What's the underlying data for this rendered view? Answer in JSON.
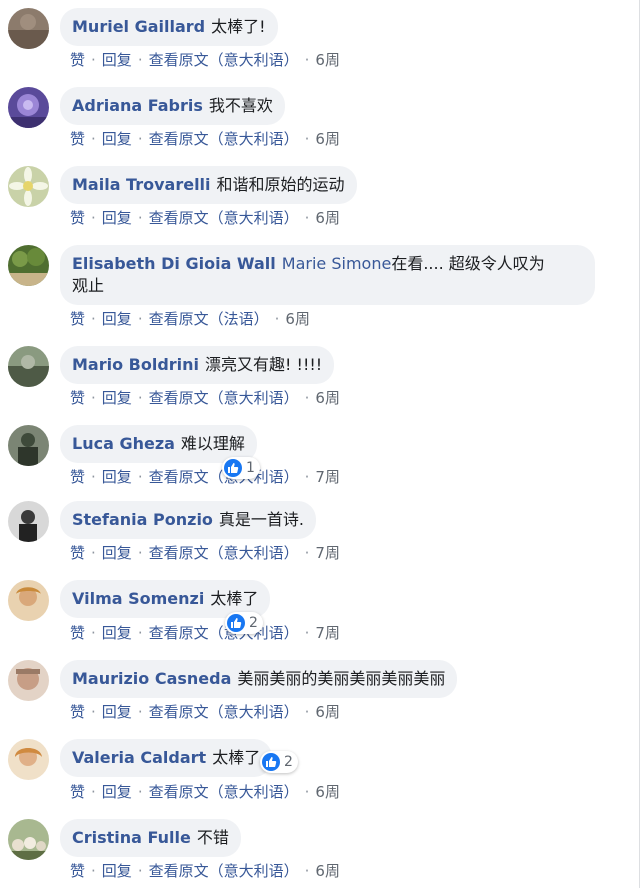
{
  "actions": {
    "like": "赞",
    "reply": "回复",
    "see_original": "查看原文",
    "separator": "·"
  },
  "comments": [
    {
      "author": "Muriel Gaillard",
      "text": "太棒了!",
      "lang": "（意大利语）",
      "time": "6周",
      "avatar_color": "#7a6a5e"
    },
    {
      "author": "Adriana Fabris",
      "text": "我不喜欢",
      "lang": "（意大利语）",
      "time": "6周",
      "avatar_color": "#6b55a8"
    },
    {
      "author": "Maila Trovarelli",
      "text": "和谐和原始的运动",
      "lang": "（意大利语）",
      "time": "6周",
      "avatar_color": "#d7dcc0"
    },
    {
      "author": "Elisabeth Di Gioia Wall",
      "mention": "Marie Simone",
      "text": "在看.... 超级令人叹为",
      "text2": "观止",
      "lang": "（法语）",
      "time": "6周",
      "avatar_color": "#5d7a3c"
    },
    {
      "author": "Mario Boldrini",
      "text": "漂亮又有趣! !!!!",
      "lang": "（意大利语）",
      "time": "6周",
      "avatar_color": "#6c7a5f"
    },
    {
      "author": "Luca Gheza",
      "text": "难以理解",
      "lang": "（意大利语）",
      "time": "7周",
      "avatar_color": "#6f7768",
      "reactions": "1"
    },
    {
      "author": "Stefania Ponzio",
      "text": "真是一首诗.",
      "lang": "（意大利语）",
      "time": "7周",
      "avatar_color": "#4a4a4a"
    },
    {
      "author": "Vilma Somenzi",
      "text": "太棒了",
      "lang": "（意大利语）",
      "time": "7周",
      "avatar_color": "#c89a70",
      "reactions": "2"
    },
    {
      "author": "Maurizio Casneda",
      "text": "美丽美丽的美丽美丽美丽美丽",
      "lang": "（意大利语）",
      "time": "6周",
      "avatar_color": "#b88a72"
    },
    {
      "author": "Valeria Caldart",
      "text": "太棒了",
      "lang": "（意大利语）",
      "time": "6周",
      "avatar_color": "#d9a070",
      "reactions": "2"
    },
    {
      "author": "Cristina Fulle",
      "text": "不错",
      "lang": "（意大利语）",
      "time": "6周",
      "avatar_color": "#8a9a70"
    }
  ],
  "colors": {
    "link": "#385898",
    "bubble": "#f0f2f5",
    "like_blue": "#1877f2"
  }
}
